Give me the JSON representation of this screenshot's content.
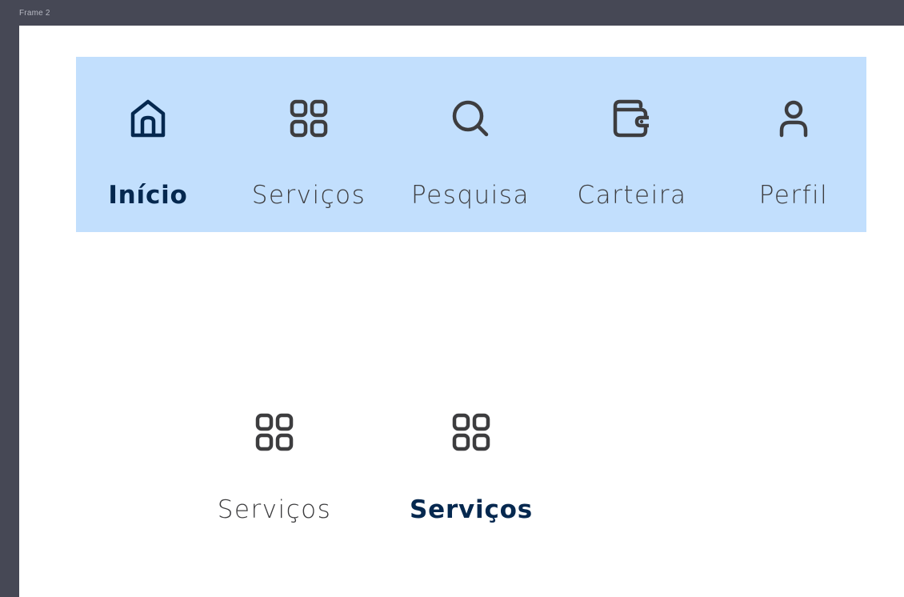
{
  "frame": {
    "label": "Frame 2"
  },
  "colors": {
    "nav_background": "#c2dffd",
    "active": "#05284f",
    "inactive": "#3d3d3f",
    "workspace": "#464855"
  },
  "nav": {
    "items": [
      {
        "label": "Início",
        "icon": "home-icon",
        "active": true
      },
      {
        "label": "Serviços",
        "icon": "grid-icon",
        "active": false
      },
      {
        "label": "Pesquisa",
        "icon": "search-icon",
        "active": false
      },
      {
        "label": "Carteira",
        "icon": "wallet-icon",
        "active": false
      },
      {
        "label": "Perfil",
        "icon": "user-icon",
        "active": false
      }
    ]
  },
  "variants": [
    {
      "label": "Serviços",
      "icon": "grid-icon",
      "active": false
    },
    {
      "label": "Serviços",
      "icon": "grid-icon",
      "active": true
    }
  ]
}
